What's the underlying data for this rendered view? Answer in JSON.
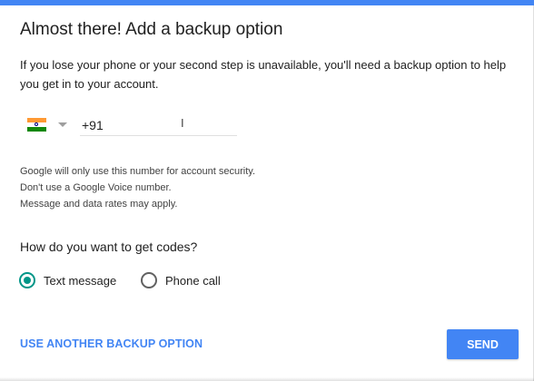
{
  "colors": {
    "accent": "#4285f4",
    "radio_selected": "#009688"
  },
  "header": {
    "title": "Almost there! Add a backup option",
    "description": "If you lose your phone or your second step is unavailable, you'll need a backup option to help you get in to your account."
  },
  "phone": {
    "country_flag": "india-flag-icon",
    "dropdown_icon": "caret-down-icon",
    "value": "+91",
    "cursor_glyph": "I"
  },
  "notes": [
    "Google will only use this number for account security.",
    "Don't use a Google Voice number.",
    "Message and data rates may apply."
  ],
  "codes": {
    "question": "How do you want to get codes?",
    "options": [
      {
        "label": "Text message",
        "selected": true
      },
      {
        "label": "Phone call",
        "selected": false
      }
    ]
  },
  "actions": {
    "another_option_label": "USE ANOTHER BACKUP OPTION",
    "send_label": "SEND"
  }
}
